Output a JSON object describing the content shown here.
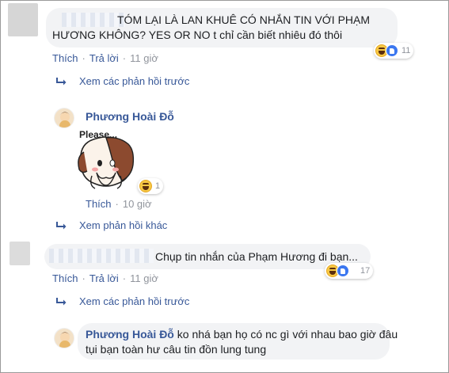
{
  "comments": [
    {
      "text_line1": "TÓM LẠI LÀ LAN KHUÊ CÓ NHẮN TIN VỚI PHẠM",
      "text_line2": "HƯƠNG KHÔNG? YES OR NO t chỉ cần biết nhiêu đó thôi",
      "like_label": "Thích",
      "reply_label": "Trả lời",
      "time": "11 giờ",
      "reaction_count": "11"
    },
    {
      "text_line1": "Chụp tin nhắn của Phạm Hương đi bạn...",
      "like_label": "Thích",
      "reply_label": "Trả lời",
      "time": "11 giờ",
      "reaction_count": "17"
    }
  ],
  "view_previous_replies": "Xem các phản hồi trước",
  "replies": [
    {
      "author": "Phương Hoài Đỗ",
      "sticker_caption": "Please...",
      "like_label": "Thích",
      "time": "10 giờ",
      "reaction_count": "1",
      "more_replies": "Xem phản hồi khác"
    },
    {
      "author": "Phương Hoài Đỗ",
      "text_line1": "ko nhá bạn họ có nc gì với nhau bao giờ đâu",
      "text_line2": "tụi bạn toàn hư câu tin đồn lung tung"
    }
  ],
  "icons": [
    "reply-arrow-icon",
    "haha-reaction-icon",
    "like-reaction-icon",
    "sticker-image"
  ],
  "colors": {
    "link": "#385898",
    "meta": "#90949c",
    "bubble": "#f2f3f5"
  }
}
